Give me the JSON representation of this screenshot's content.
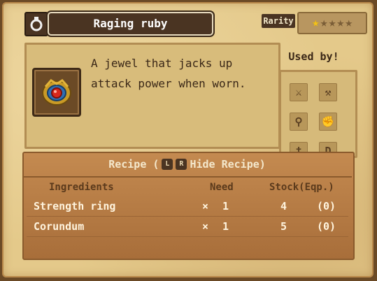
{
  "header": {
    "item_name": "Raging ruby",
    "rarity_label": "Rarity",
    "rarity_stars": 1,
    "rarity_max": 5,
    "rarity_star_glyph": "★"
  },
  "description": {
    "line1": "A jewel that jacks up",
    "line2": "attack power when worn."
  },
  "used_by": {
    "title": "Used by!",
    "weapons": [
      {
        "icon": "sword-icon",
        "glyph": "⚔"
      },
      {
        "icon": "dual-icon",
        "glyph": "⚒"
      },
      {
        "icon": "staff-icon",
        "glyph": "⚲"
      },
      {
        "icon": "fist-icon",
        "glyph": "✊"
      },
      {
        "icon": "dagger-icon",
        "glyph": "†"
      },
      {
        "icon": "bow-icon",
        "glyph": "D"
      }
    ]
  },
  "recipe": {
    "title": "Recipe (",
    "key_l": "L",
    "key_r": "R",
    "hide_label": "Hide Recipe)",
    "columns": {
      "ingredients": "Ingredients",
      "need": "Need",
      "stock": "Stock(Eqp.)"
    },
    "rows": [
      {
        "name": "Strength ring",
        "times": "×",
        "need": "1",
        "stock": "4",
        "eqp": "(0)"
      },
      {
        "name": "Corundum",
        "times": "×",
        "need": "1",
        "stock": "5",
        "eqp": "(0)"
      }
    ]
  },
  "colors": {
    "parchment": "#e4c98a",
    "dark_bar": "#4a3422",
    "star_on": "#f2c21b",
    "star_off": "#7b5e37",
    "recipe_bg": "#b97d45"
  }
}
